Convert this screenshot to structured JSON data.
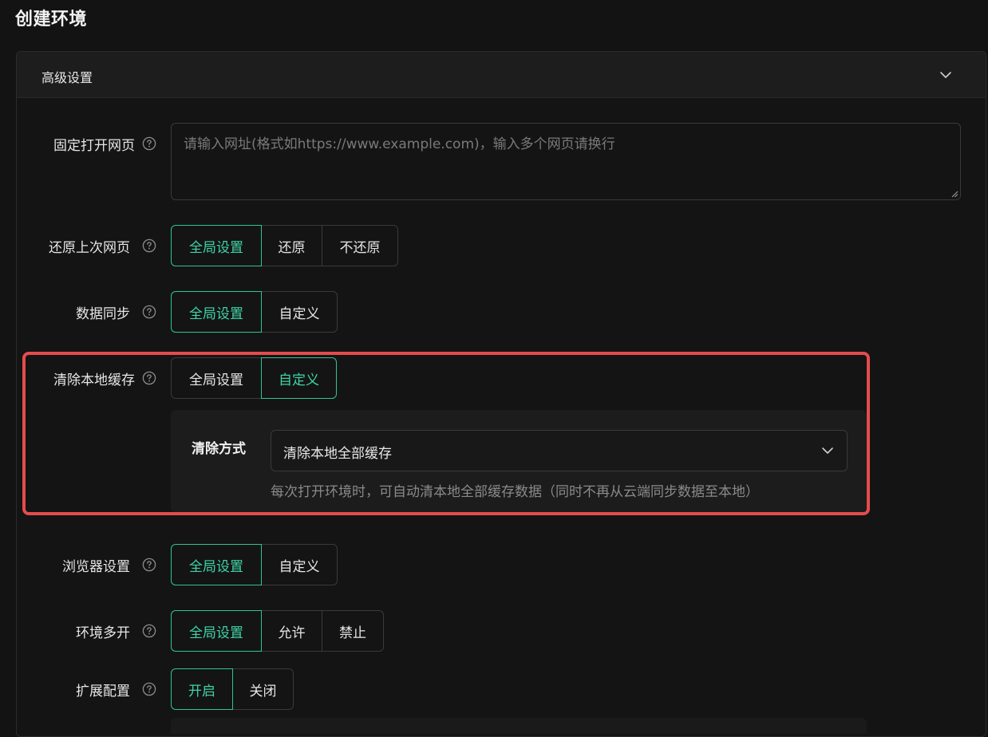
{
  "page": {
    "title": "创建环境"
  },
  "panel": {
    "title": "高级设置",
    "toggle_icon": "chevron-down-icon"
  },
  "fixed_pages": {
    "label": "固定打开网页",
    "placeholder": "请输入网址(格式如https://www.example.com)，输入多个网页请换行",
    "value": ""
  },
  "restore_pages": {
    "label": "还原上次网页",
    "options": [
      "全局设置",
      "还原",
      "不还原"
    ],
    "selected": "全局设置"
  },
  "data_sync": {
    "label": "数据同步",
    "options": [
      "全局设置",
      "自定义"
    ],
    "selected": "全局设置"
  },
  "clear_cache": {
    "label": "清除本地缓存",
    "options": [
      "全局设置",
      "自定义"
    ],
    "selected": "自定义",
    "method": {
      "label": "清除方式",
      "value": "清除本地全部缓存",
      "hint": "每次打开环境时，可自动清本地全部缓存数据（同时不再从云端同步数据至本地）"
    }
  },
  "browser_settings": {
    "label": "浏览器设置",
    "options": [
      "全局设置",
      "自定义"
    ],
    "selected": "全局设置"
  },
  "multi_open": {
    "label": "环境多开",
    "options": [
      "全局设置",
      "允许",
      "禁止"
    ],
    "selected": "全局设置"
  },
  "extensions": {
    "label": "扩展配置",
    "options": [
      "开启",
      "关闭"
    ],
    "selected": "开启"
  },
  "colors": {
    "accent": "#3fd3a6",
    "highlight": "#e54c4c",
    "background": "#131313"
  }
}
